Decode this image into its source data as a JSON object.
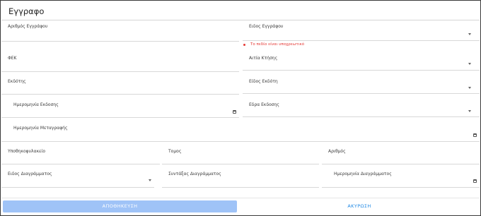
{
  "dialog": {
    "title": "Εγγραφο"
  },
  "fields": {
    "document_number": {
      "label": "Αριθμός Εγγράφου",
      "value": ""
    },
    "document_type": {
      "label": "Ειδος Εγγράφου",
      "value": "",
      "error": "Το πεδίο είναι υποχρεωτικό"
    },
    "fek": {
      "label": "ΦΕΚ",
      "value": ""
    },
    "acquisition_cause": {
      "label": "Αιτία Κτήσης",
      "value": ""
    },
    "publisher": {
      "label": "Εκδότης",
      "value": ""
    },
    "publisher_type": {
      "label": "Είδος Εκδότη",
      "value": ""
    },
    "issue_date": {
      "label": "Ημερομηνία Εκδοσης",
      "value": ""
    },
    "issue_seat": {
      "label": "Εδρα Εκδοσης",
      "value": ""
    },
    "transfer_date": {
      "label": "Ημερομηνία Μεταγραφής",
      "value": ""
    },
    "mortgage_office": {
      "label": "Υποθηκοφυλακείο",
      "value": ""
    },
    "volume": {
      "label": "Τομος",
      "value": ""
    },
    "number": {
      "label": "Αριθμός",
      "value": ""
    },
    "diagram_type": {
      "label": "Ειδος Διαγράμματος",
      "value": ""
    },
    "diagram_author": {
      "label": "Συντάξας Διαγράμματος",
      "value": ""
    },
    "diagram_date": {
      "label": "Ημερομηνία Διαγράμματος",
      "value": ""
    }
  },
  "buttons": {
    "save": "ΑΠΟΘΗΚΕΥΣΗ",
    "cancel": "ΑΚΥΡΩΣΗ"
  },
  "colors": {
    "accent": "#1e88e5",
    "save_disabled": "#9fc3f7",
    "error": "#e53935"
  },
  "icons": {
    "select": "chevron-down-icon",
    "date": "calendar-icon"
  }
}
